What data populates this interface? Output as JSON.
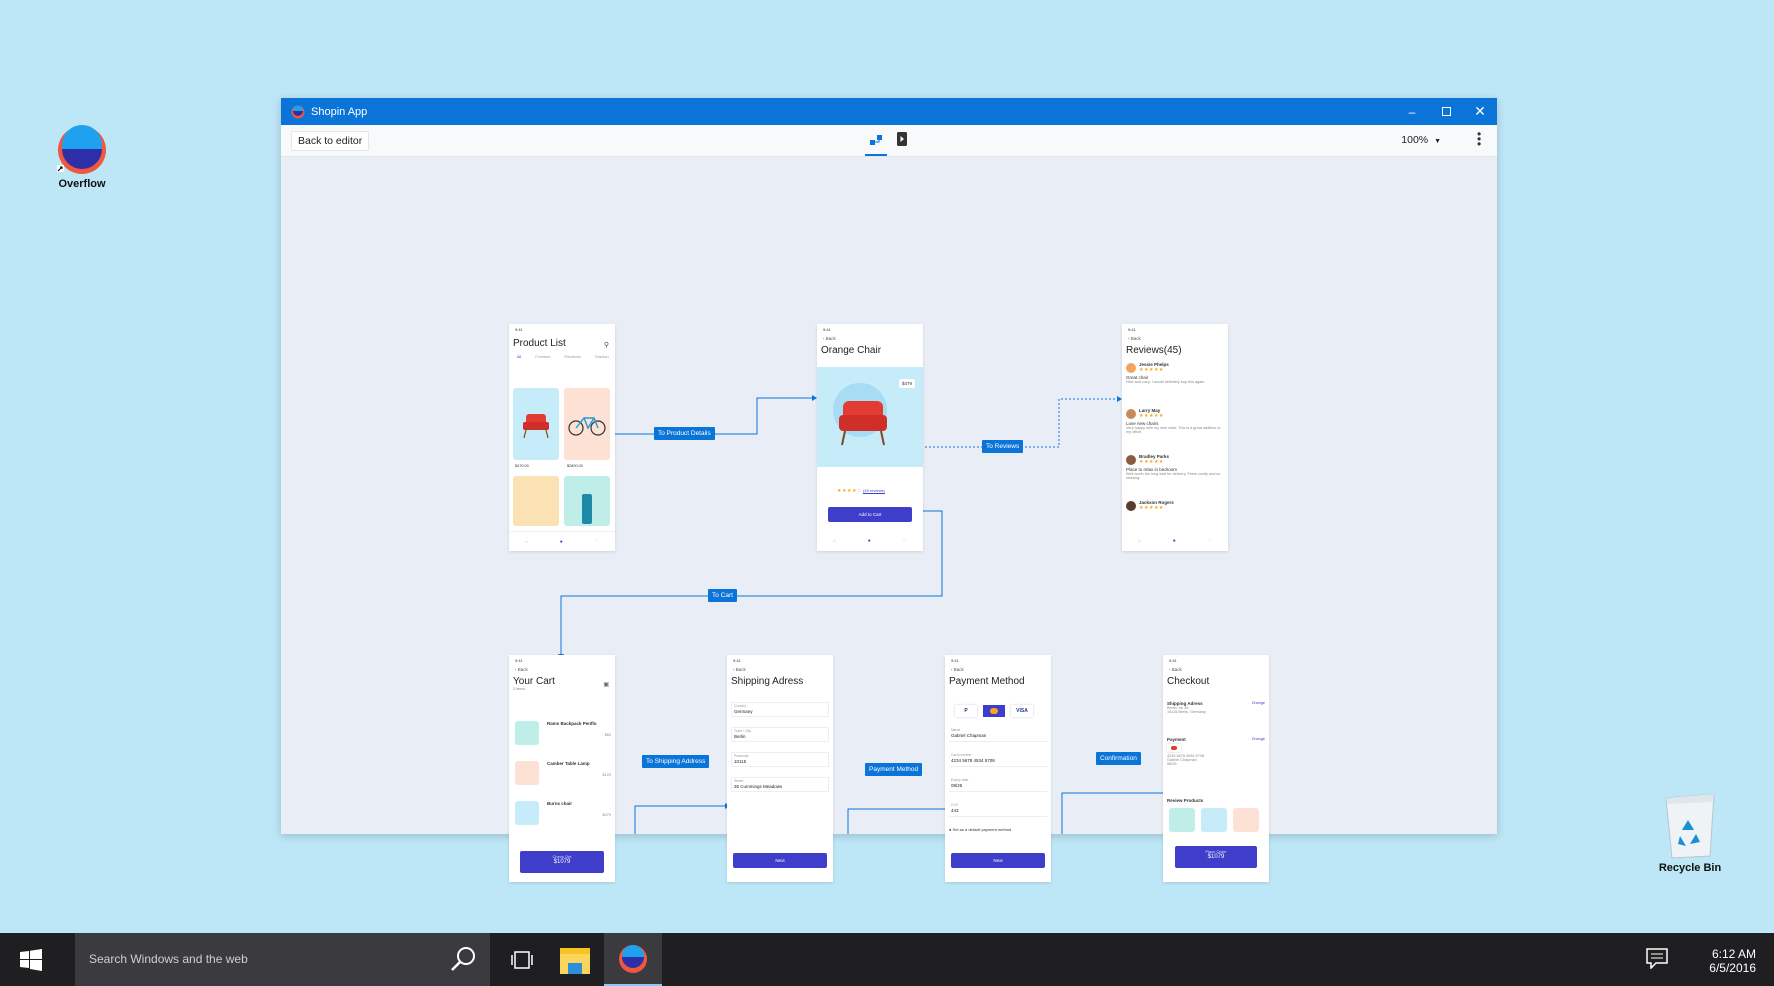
{
  "desktop": {
    "overflow_label": "Overflow",
    "recycle_label": "Recycle Bin"
  },
  "window": {
    "title": "Shopin App",
    "back_to_editor": "Back to editor",
    "zoom": "100%"
  },
  "flow_labels": {
    "to_product_details": "To Product Details",
    "to_reviews": "To Reviews",
    "to_cart": "To Cart",
    "to_shipping": "To Shipping Address",
    "payment_method": "Payment Method",
    "confirmation": "Confirmation"
  },
  "screens": {
    "product_list": {
      "time": "9:41",
      "title": "Product List",
      "tabs": [
        "All",
        "Furniture",
        "Electronic",
        "Fashion"
      ],
      "prices": [
        "$479.00",
        "$2800.00"
      ]
    },
    "orange_chair": {
      "time": "9:41",
      "back": "Back",
      "title": "Orange Chair",
      "price": "$479",
      "reviews_link": "(45 reviews)",
      "add_to_cart": "Add to Cart"
    },
    "reviews": {
      "time": "9:41",
      "back": "Back",
      "title": "Reviews(45)",
      "items": [
        {
          "name": "Jessie Phelps",
          "headline": "Great chair",
          "text": "Nice and cozy. I would definitely buy this again."
        },
        {
          "name": "Larry May",
          "headline": "Love new chairs",
          "text": "Very happy with my new chair. This is a great addition to my office."
        },
        {
          "name": "Bradley Parks",
          "headline": "Place to relax in bedroom",
          "text": "Well worth the long wait for delivery. Feels comfy and so relaxing."
        },
        {
          "name": "Jackson Rogers",
          "headline": "",
          "text": ""
        }
      ]
    },
    "cart": {
      "time": "9:41",
      "back": "Back",
      "title": "Your Cart",
      "subtitle": "3 items",
      "items": [
        {
          "name": "Rams Backpack Penflo",
          "price": "$60"
        },
        {
          "name": "Camber Table Lamp",
          "price": "$120"
        },
        {
          "name": "Burns chair",
          "price": "$479"
        }
      ],
      "checkout_label": "Check Out",
      "total": "$1079"
    },
    "shipping": {
      "time": "9:41",
      "back": "Back",
      "title": "Shipping Adress",
      "fields": [
        {
          "label": "Country",
          "value": "Germany"
        },
        {
          "label": "Town / City",
          "value": "Berlin"
        },
        {
          "label": "Postcode",
          "value": "10115"
        },
        {
          "label": "Street",
          "value": "35 Cummings Meadows"
        }
      ],
      "next": "Next"
    },
    "payment": {
      "time": "9:41",
      "back": "Back",
      "title": "Payment Method",
      "methods": [
        "P",
        "",
        "VISA"
      ],
      "fields": [
        {
          "label": "Name",
          "value": "Gabriel Chapman"
        },
        {
          "label": "Card number",
          "value": "4234 5678 4534 5708"
        },
        {
          "label": "Expiry date",
          "value": "08/25"
        },
        {
          "label": "CVV",
          "value": "443"
        }
      ],
      "default_label": "Set as a default payment method",
      "next": "Next"
    },
    "checkout": {
      "time": "9:41",
      "back": "Back",
      "title": "Checkout",
      "shipping_heading": "Shipping Adress",
      "shipping_change": "Change",
      "shipping_lines": [
        "Berlin, str 35",
        "10115 Berlin, Germany"
      ],
      "payment_heading": "Payment",
      "payment_change": "Change",
      "payment_lines": [
        "4234 5678 4534 5708",
        "Gabriel Chapman",
        "08/25"
      ],
      "review_heading": "Review Products",
      "place_order": "Place Order",
      "total": "$1079"
    }
  },
  "taskbar": {
    "search_placeholder": "Search Windows and the web",
    "time": "6:12 AM",
    "date": "6/5/2016"
  }
}
